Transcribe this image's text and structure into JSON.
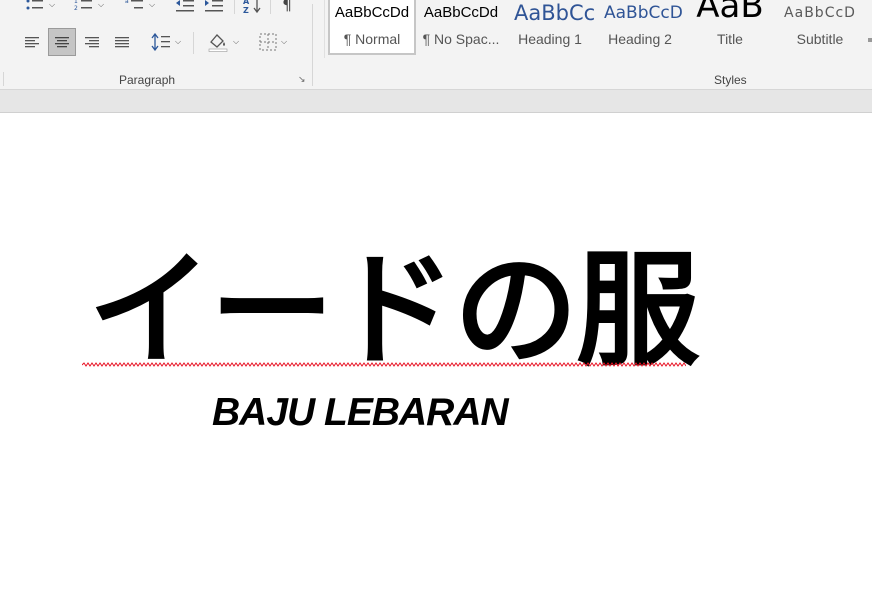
{
  "ribbon": {
    "paragraph_group": {
      "label": "Paragraph",
      "launcher_icon": "dialog-launcher-icon",
      "row1_icons": [
        "bullets-icon",
        "numbering-icon",
        "multilevel-list-icon",
        "decrease-indent-icon",
        "increase-indent-icon",
        "sort-icon",
        "show-formatting-marks-icon"
      ],
      "row2_icons": [
        "align-left-icon",
        "align-center-icon",
        "align-right-icon",
        "justify-icon",
        "line-spacing-icon",
        "shading-icon",
        "borders-icon"
      ],
      "active_alignment": "align-center"
    },
    "styles_group": {
      "label": "Styles",
      "tiles": [
        {
          "preview": "AaBbCcDd",
          "name": "¶ Normal",
          "selected": true
        },
        {
          "preview": "AaBbCcDd",
          "name": "¶ No Spac...",
          "selected": false
        },
        {
          "preview": "AaBbCc",
          "name": "Heading 1",
          "selected": false
        },
        {
          "preview": "AaBbCcD",
          "name": "Heading 2",
          "selected": false
        },
        {
          "preview": "AaB",
          "name": "Title",
          "selected": false
        },
        {
          "preview": "AaBbCcD",
          "name": "Subtitle",
          "selected": false
        }
      ]
    }
  },
  "document": {
    "title": "イードの服",
    "subtitle": "BAJU LEBARAN",
    "spellcheck_color": "#e81123"
  },
  "colors": {
    "ribbon_bg": "#f3f3f3",
    "heading_blue": "#2f5496",
    "text": "#000000"
  }
}
